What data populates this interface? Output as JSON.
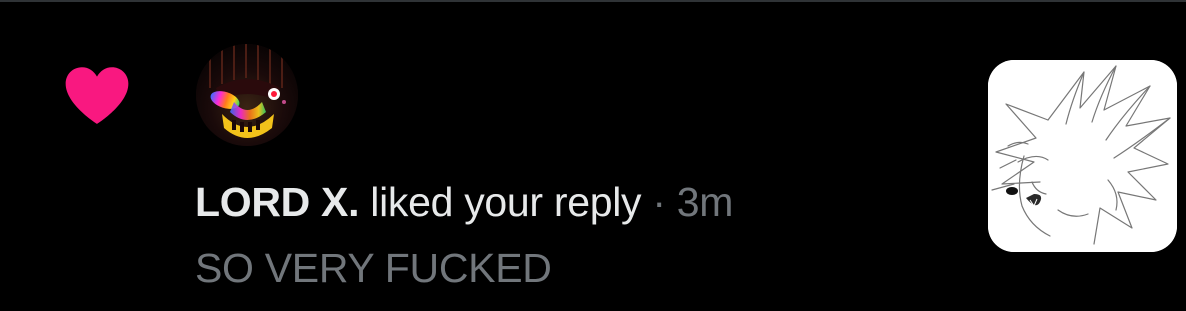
{
  "notification": {
    "type": "like",
    "author_name": "LORD X.",
    "action_text": "liked your reply",
    "separator": "·",
    "timestamp": "3m",
    "reply_text": "SO VERY FUCKED"
  },
  "colors": {
    "background": "#000000",
    "like_heart": "#f91880",
    "primary_text": "#e7e9ea",
    "secondary_text": "#71767b"
  },
  "icons": {
    "like": "heart-icon",
    "avatar": "user-avatar",
    "media": "reply-image-thumbnail"
  }
}
